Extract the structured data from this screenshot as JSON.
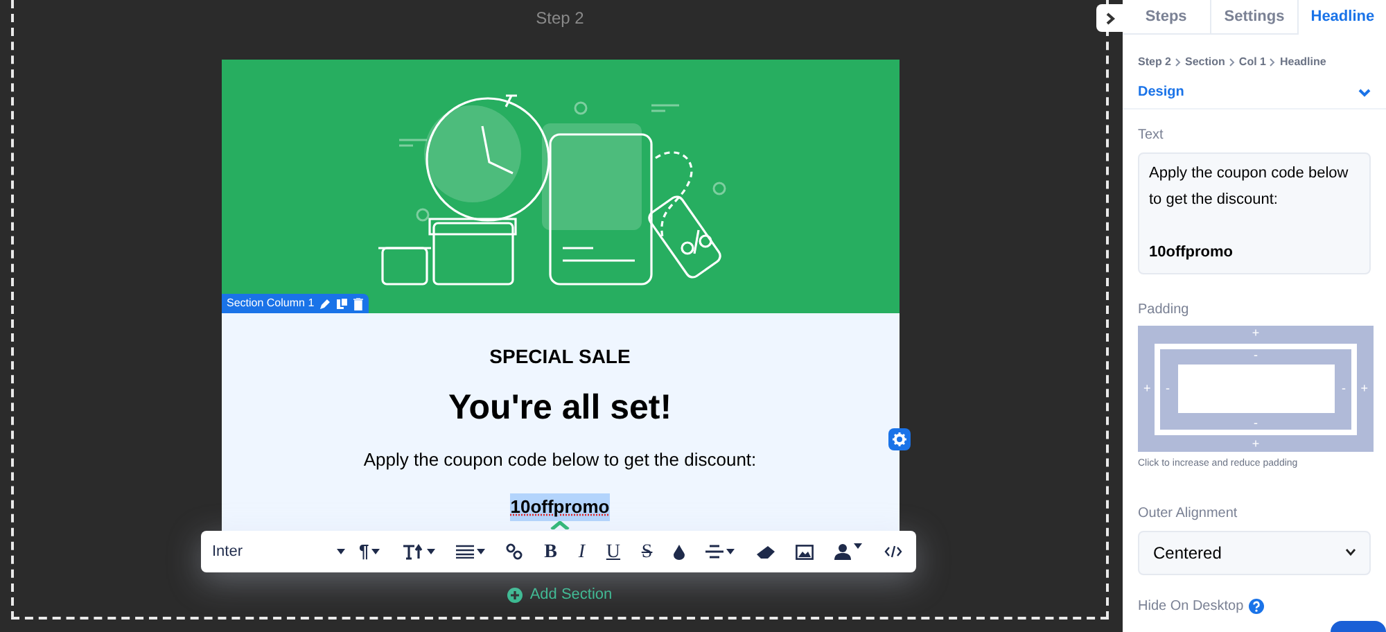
{
  "canvas": {
    "title": "Step 2",
    "section_label": "Section Column 1",
    "eyebrow": "SPECIAL SALE",
    "heading": "You're all set!",
    "body": "Apply the coupon code below to get the discount:",
    "code": "10offpromo",
    "add_section": "Add Section"
  },
  "toolbar": {
    "font": "Inter",
    "glyph_buttons": [
      "¶",
      "B",
      "I",
      "U",
      "S"
    ]
  },
  "panel": {
    "tabs": [
      {
        "label": "Steps",
        "selected": false
      },
      {
        "label": "Settings",
        "selected": false
      },
      {
        "label": "Headline",
        "selected": true
      }
    ],
    "breadcrumb": [
      "Step 2",
      "Section",
      "Col 1",
      "Headline"
    ],
    "design": {
      "label": "Design",
      "expanded": true
    },
    "text_label": "Text",
    "text_value": "Apply the coupon code below to get the discount:\n\n**10offpromo**",
    "padding_label": "Padding",
    "padding_marks": {
      "outer_top": "+",
      "inner_top": "-",
      "outer_left": "+",
      "inner_left": "-",
      "inner_right": "-",
      "outer_right": "+",
      "inner_bottom": "-",
      "outer_bottom": "+"
    },
    "padding_hint": "Click to increase and reduce padding",
    "alignment_label": "Outer Alignment",
    "alignment_value": "Centered",
    "hide_label": "Hide On Desktop"
  }
}
